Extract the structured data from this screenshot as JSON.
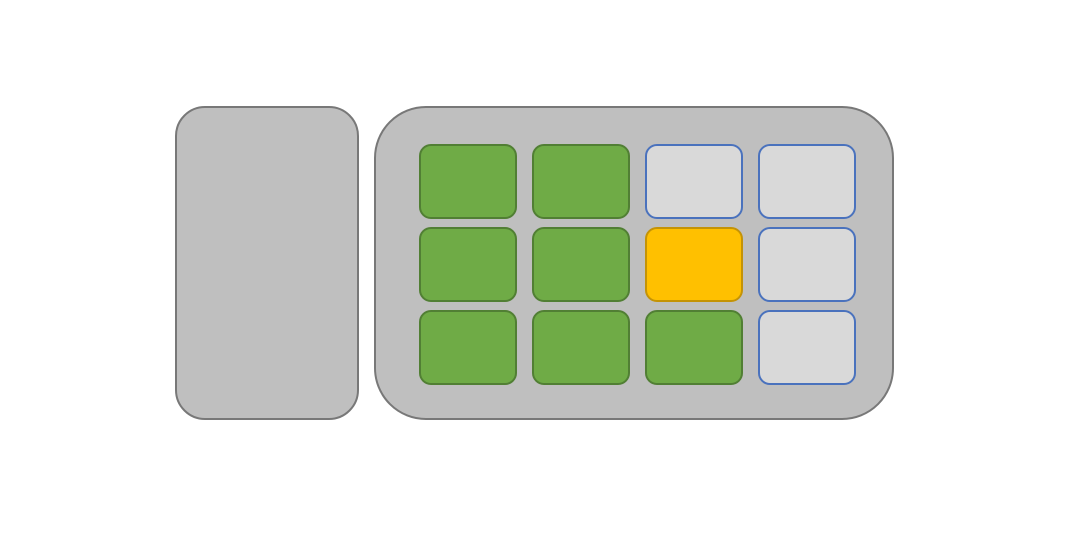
{
  "colors": {
    "panel_fill": "#bfbfbf",
    "panel_border": "#787878",
    "green_fill": "#6fab46",
    "green_border": "#517f34",
    "empty_fill": "#d9d9d9",
    "empty_border": "#4a72bd",
    "highlight_fill": "#ffc000",
    "highlight_border": "#c49306"
  },
  "grid": {
    "rows": [
      [
        "green",
        "green",
        "empty",
        "empty"
      ],
      [
        "green",
        "green",
        "highlight",
        "empty"
      ],
      [
        "green",
        "green",
        "green",
        "empty"
      ]
    ]
  }
}
